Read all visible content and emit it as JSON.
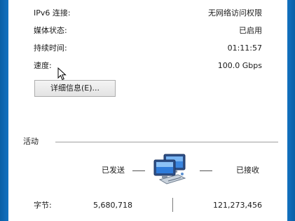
{
  "connection": {
    "rows": [
      {
        "label": "IPv6 连接:",
        "value": "无网络访问权限"
      },
      {
        "label": "媒体状态:",
        "value": "已启用"
      },
      {
        "label": "持续时间:",
        "value": "01:11:57"
      },
      {
        "label": "速度:",
        "value": "100.0 Gbps"
      }
    ],
    "details_button": "详细信息(E)..."
  },
  "activity": {
    "heading": "活动",
    "sent_label": "已发送",
    "received_label": "已接收",
    "bytes_label": "字节:",
    "bytes_sent": "5,680,718",
    "bytes_received": "121,273,456"
  },
  "icons": [
    "mouse-cursor",
    "network-computers-icon"
  ],
  "colors": {
    "window_frame": "#0b5fa8",
    "panel": "#ffffff",
    "button_border": "#adadad"
  }
}
